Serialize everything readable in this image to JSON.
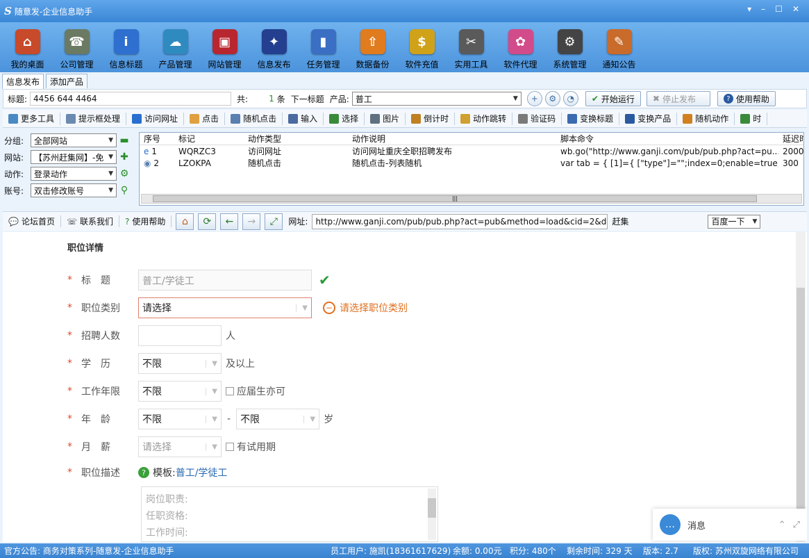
{
  "app": {
    "logo": "S",
    "title": "随意发-企业信息助手",
    "win_buttons": [
      "▾",
      "–",
      "☐",
      "✕"
    ]
  },
  "toolbar": [
    {
      "label": "我的桌面",
      "icon": "home-icon",
      "color": "#c74a2a",
      "glyph": "⌂"
    },
    {
      "label": "公司管理",
      "icon": "phone-icon",
      "color": "#6b7a63",
      "glyph": "☎"
    },
    {
      "label": "信息标题",
      "icon": "info-icon",
      "color": "#2e6fcf",
      "glyph": "i"
    },
    {
      "label": "产品管理",
      "icon": "cloud-icon",
      "color": "#2f8ac0",
      "glyph": "☁"
    },
    {
      "label": "网站管理",
      "icon": "gift-box-icon",
      "color": "#b8262f",
      "glyph": "▣"
    },
    {
      "label": "信息发布",
      "icon": "magic-wand-icon",
      "color": "#243f8f",
      "glyph": "✦"
    },
    {
      "label": "任务管理",
      "icon": "bar-chart-icon",
      "color": "#3a6fc4",
      "glyph": "▮"
    },
    {
      "label": "数据备份",
      "icon": "upload-cloud-icon",
      "color": "#e07b1e",
      "glyph": "⇧"
    },
    {
      "label": "软件充值",
      "icon": "money-chart-icon",
      "color": "#d0a21a",
      "glyph": "$"
    },
    {
      "label": "实用工具",
      "icon": "tools-icon",
      "color": "#5a5a5a",
      "glyph": "✂"
    },
    {
      "label": "软件代理",
      "icon": "present-icon",
      "color": "#d24b8a",
      "glyph": "✿"
    },
    {
      "label": "系统管理",
      "icon": "gear-icon",
      "color": "#444",
      "glyph": "⚙"
    },
    {
      "label": "通知公告",
      "icon": "notebook-icon",
      "color": "#c96b2a",
      "glyph": "✎"
    }
  ],
  "tabs": [
    "信息发布",
    "添加产品"
  ],
  "row1": {
    "title_label": "标题:",
    "title_value": "4456 644 4464",
    "total_label": "共:",
    "count": "1",
    "count_unit": "条",
    "next_label": "下一标题",
    "product_label": "产品:",
    "product_value": "普工",
    "start": "开始运行",
    "stop": "停止发布",
    "help": "使用帮助"
  },
  "actions": [
    {
      "label": "更多工具",
      "color": "#4a8ac4"
    },
    {
      "label": "提示框处理",
      "color": "#6a8ab0"
    },
    {
      "label": "访问网址",
      "color": "#2a6fd0"
    },
    {
      "label": "点击",
      "color": "#e0a040"
    },
    {
      "label": "随机点击",
      "color": "#5a7fb0"
    },
    {
      "label": "输入",
      "color": "#4a6aa0"
    },
    {
      "label": "选择",
      "color": "#3a8a3a"
    },
    {
      "label": "图片",
      "color": "#607080"
    },
    {
      "label": "倒计时",
      "color": "#c08020"
    },
    {
      "label": "动作跳转",
      "color": "#d0a030"
    },
    {
      "label": "验证码",
      "color": "#7a7a7a"
    },
    {
      "label": "变换标题",
      "color": "#3a6ab0"
    },
    {
      "label": "变换产品",
      "color": "#2a5aa0"
    },
    {
      "label": "随机动作",
      "color": "#d08020"
    },
    {
      "label": "时",
      "color": "#3a8a3a"
    }
  ],
  "left": {
    "group_label": "分组:",
    "group_value": "全部网站",
    "site_label": "网站:",
    "site_value": "【苏州赶集网】-免",
    "action_label": "动作:",
    "action_value": "登录动作",
    "account_label": "账号:",
    "account_value": "双击修改账号"
  },
  "grid": {
    "headers": [
      "序号",
      "标记",
      "动作类型",
      "动作说明",
      "脚本命令",
      "延迟时"
    ],
    "rows": [
      [
        "1",
        "WQRZC3",
        "访问网址",
        "访问网址重庆全职招聘发布",
        "wb.go(\"http://www.ganji.com/pub/pub.php?act=pu...",
        "2000"
      ],
      [
        "2",
        "LZOKPA",
        "随机点击",
        "随机点击-列表随机",
        "var tab = { [1]={ [\"type\"]=\"\";index=0;enable=true;i...",
        "300"
      ]
    ]
  },
  "nav": {
    "forum": "论坛首页",
    "contact": "联系我们",
    "help": "使用帮助",
    "url_label": "网址:",
    "url": "http://www.ganji.com/pub/pub.php?act=pub&method=load&cid=2&d",
    "site": "赶集",
    "engine": "百度一下"
  },
  "form": {
    "heading": "职位详情",
    "title_label": "标　题",
    "title_value": "普工/学徒工",
    "cat_label": "职位类别",
    "cat_value": "请选择",
    "cat_error": "请选择职位类别",
    "count_label": "招聘人数",
    "count_unit": "人",
    "edu_label": "学　历",
    "edu_value": "不限",
    "edu_suffix": "及以上",
    "years_label": "工作年限",
    "years_value": "不限",
    "fresh": "应届生亦可",
    "age_label": "年　龄",
    "age_from": "不限",
    "age_dash": "-",
    "age_to": "不限",
    "age_unit": "岁",
    "salary_label": "月　薪",
    "salary_value": "请选择",
    "trial": "有试用期",
    "desc_label": "职位描述",
    "template_label": "模板:",
    "template_value": "普工/学徒工",
    "desc_lines": [
      "岗位职责:",
      "任职资格:",
      "工作时间:"
    ]
  },
  "chat": {
    "label": "消息"
  },
  "status": {
    "notice": "官方公告: 商务对策系列-随意发-企业信息助手",
    "user": "员工用户: 施凯(18361617629)",
    "balance": "余额: 0.00元",
    "points": "积分: 480个",
    "remain": "剩余时间: 329 天",
    "version": "版本: 2.7",
    "copyright": "版权: 苏州双旋网络有限公司"
  }
}
